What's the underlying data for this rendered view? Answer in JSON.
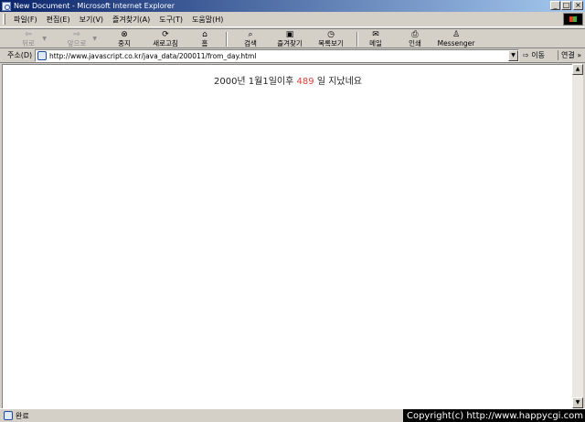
{
  "window": {
    "title": "New Document - Microsoft Internet Explorer",
    "minimize_label": "_",
    "maximize_label": "□",
    "close_label": "×"
  },
  "menu": {
    "items": [
      {
        "label": "파일(F)"
      },
      {
        "label": "편집(E)"
      },
      {
        "label": "보기(V)"
      },
      {
        "label": "즐겨찾기(A)"
      },
      {
        "label": "도구(T)"
      },
      {
        "label": "도움말(H)"
      }
    ]
  },
  "toolbar": {
    "back": "뒤로",
    "forward": "앞으로",
    "stop": "중지",
    "refresh": "새로고침",
    "home": "홈",
    "search": "검색",
    "favorites": "즐겨찾기",
    "history": "목록보기",
    "mail": "메일",
    "print": "인쇄",
    "messenger": "Messenger"
  },
  "address": {
    "label": "주소(D)",
    "url": "http://www.javascript.co.kr/java_data/200011/from_day.html",
    "go": "이동",
    "links": "연결 »"
  },
  "content": {
    "prefix": "2000년 1월1일이후",
    "days": "489",
    "suffix": "일 지났네요",
    "days_color": "#e04040"
  },
  "status": {
    "text": "완료",
    "copyright": "Copyright(c) http://www.happycgi.com"
  }
}
